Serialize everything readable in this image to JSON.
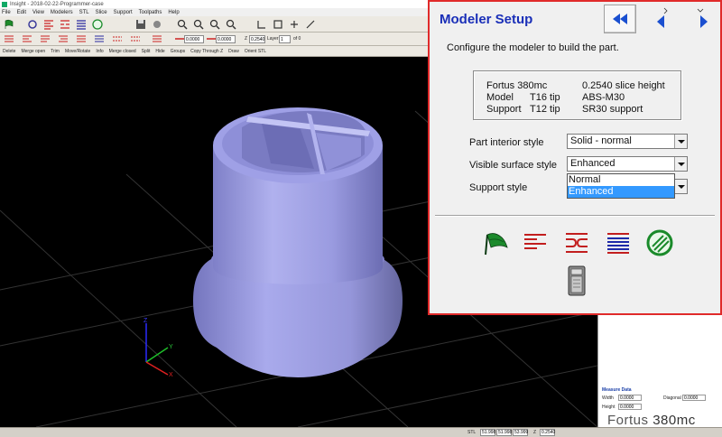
{
  "app": {
    "window_title": "Insight - 2018-02-22-Programmer-case",
    "menus": [
      "File",
      "Edit",
      "View",
      "Modelers",
      "STL",
      "Slice",
      "Support",
      "Toolpaths",
      "Help"
    ],
    "toolbar2": {
      "field1": "0.0000",
      "field2": "0.0000",
      "z_label": "Z",
      "z_value": "0.2540",
      "layer_label": "Layer",
      "layer_value": "1",
      "of_label": "of 0"
    },
    "commands": [
      "Delete",
      "Merge open",
      "Trim",
      "Move/Rotate",
      "Info",
      "Merge closed",
      "Split",
      "Hide",
      "Groups",
      "Copy Through Z",
      "Draw",
      "Orient STL"
    ]
  },
  "viewport": {
    "background": "#000000",
    "model_color": "#a7a8e8",
    "grid_color": "#3a3a3a",
    "axis": {
      "x_label": "X",
      "y_label": "Y",
      "z_label": "Z"
    }
  },
  "sidepanel": {
    "measure_title": "Measure Data",
    "width_label": "Width",
    "width_value": "0.0000",
    "diagonal_label": "Diagonal",
    "diagonal_value": "0.0000",
    "height_label": "Height",
    "height_value": "0.0000",
    "brand_name": "Fortus",
    "brand_model": "380mc"
  },
  "statusbar": {
    "mode": "STL",
    "x": "51.998",
    "y": "51.998",
    "zcoord": "53.999",
    "z_label": "Z",
    "z_value": "0.2540"
  },
  "dialog": {
    "title": "Modeler Setup",
    "description": "Configure the modeler to build the part.",
    "info": {
      "modeler": "Fortus 380mc",
      "slice": "0.2540 slice height",
      "model_label": "Model",
      "model_tip": "T16 tip",
      "model_material": "ABS-M30",
      "support_label": "Support",
      "support_tip": "T12 tip",
      "support_material": "SR30 support"
    },
    "part_interior_label": "Part interior style",
    "part_interior_value": "Solid - normal",
    "visible_surface_label": "Visible surface style",
    "visible_surface_value": "Enhanced",
    "support_style_label": "Support style",
    "dropdown_options": [
      "Normal",
      "Enhanced"
    ],
    "dropdown_selected": "Enhanced",
    "accent_color": "#1a2fb8",
    "border_color": "#e02a2a"
  },
  "icons": {
    "nav": [
      "rewind-double-icon",
      "prev-icon",
      "next-icon"
    ],
    "actions": [
      "green-flag-icon",
      "red-toolpath-lines-icon",
      "curves-icon",
      "blue-red-lines-icon",
      "green-circle-hatch-icon",
      "printer-icon"
    ]
  }
}
